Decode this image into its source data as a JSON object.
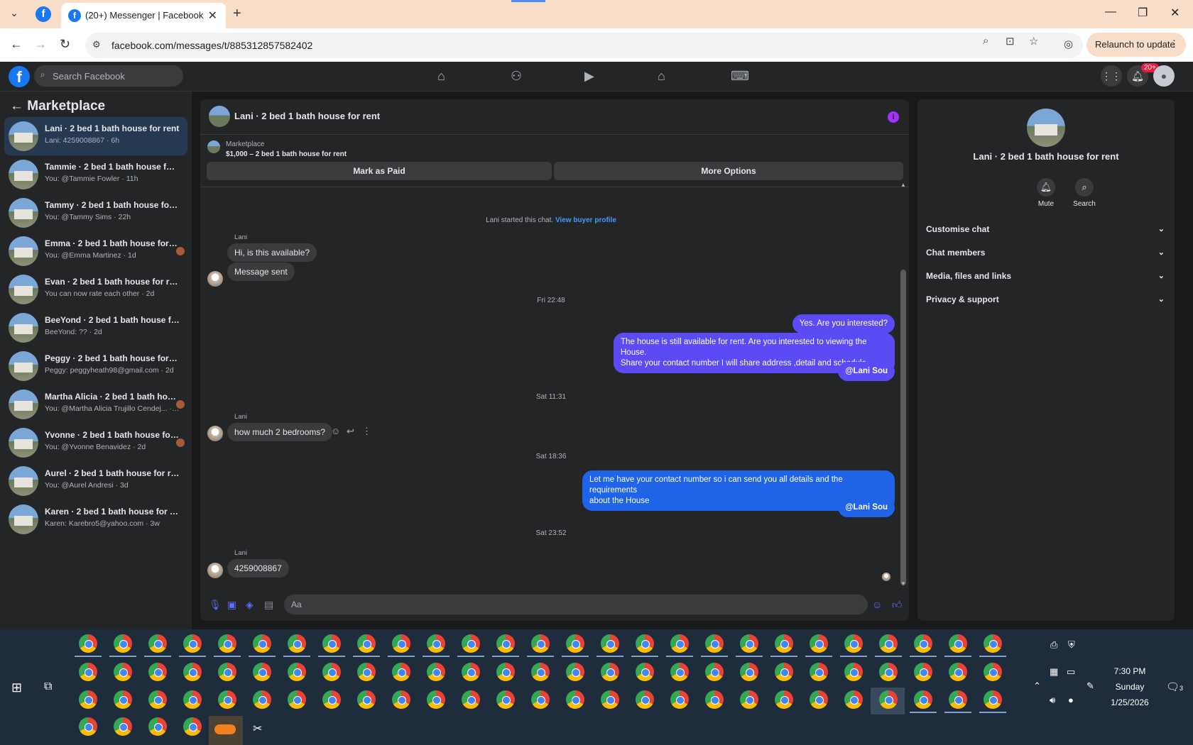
{
  "browser": {
    "tab_title": "(20+) Messenger | Facebook",
    "url": "facebook.com/messages/t/885312857582402",
    "relaunch_label": "Relaunch to update"
  },
  "fb": {
    "search_placeholder": "Search Facebook",
    "notif_badge": "20+"
  },
  "sidebar": {
    "title": "Marketplace",
    "items": [
      {
        "name": "Lani · 2 bed 1 bath house for rent",
        "sub": "Lani: 4259008867 · 6h"
      },
      {
        "name": "Tammie · 2 bed 1 bath house for re...",
        "sub": "You: @Tammie Fowler · 11h"
      },
      {
        "name": "Tammy · 2 bed 1 bath house for rent",
        "sub": "You: @Tammy Sims · 22h"
      },
      {
        "name": "Emma · 2 bed 1 bath house for r...",
        "sub": "You: @Emma Martinez · 1d"
      },
      {
        "name": "Evan · 2 bed 1 bath house for rent",
        "sub": "You can now rate each other · 2d"
      },
      {
        "name": "BeeYond · 2 bed 1 bath house for r...",
        "sub": "BeeYond: ?? · 2d"
      },
      {
        "name": "Peggy · 2 bed 1 bath house for rent",
        "sub": "Peggy: peggyheath98@gmail.com · 2d"
      },
      {
        "name": "Martha Alicia · 2 bed 1 bath hou...",
        "sub": "You: @Martha Alicia Trujillo Cendej... · 2d"
      },
      {
        "name": "Yvonne · 2 bed 1 bath house for ...",
        "sub": "You: @Yvonne Benavidez · 2d"
      },
      {
        "name": "Aurel · 2 bed 1 bath house for rent",
        "sub": "You: @Aurel Andresi · 3d"
      },
      {
        "name": "Karen · 2 bed 1 bath house for rent",
        "sub": "Karen: Karebro5@yahoo.com · 3w"
      }
    ]
  },
  "chat": {
    "title": "Lani · 2 bed 1 bath house for rent",
    "marketplace_label": "Marketplace",
    "listing": "$1,000 – 2 bed 1 bath house for rent",
    "mark_paid": "Mark as Paid",
    "more_options": "More Options",
    "started_text": "Lani started this chat.",
    "view_profile": "View buyer profile",
    "sender": "Lani",
    "m1": "Hi, is this available?",
    "m2": "Message sent",
    "t1": "Fri 22:48",
    "o1": "Yes. Are you interested?",
    "o2a": "The house is still available for rent. Are you interested to viewing  the House.",
    "o2b": "Share your contact number I will share address ,detail and schedule",
    "mention": "@Lani Sou",
    "t2": "Sat 11:31",
    "m3": "how much 2 bedrooms?",
    "t3": "Sat 18:36",
    "o3a": "Let me have your contact number so i can send you all details and the requirements",
    "o3b": "about the House",
    "t4": "Sat 23:52",
    "m4": "4259008867",
    "composer_placeholder": "Aa"
  },
  "right_panel": {
    "name": "Lani · 2 bed 1 bath house for rent",
    "mute": "Mute",
    "search": "Search",
    "sections": [
      "Customise chat",
      "Chat members",
      "Media, files and links",
      "Privacy & support"
    ]
  },
  "taskbar": {
    "time": "7:30 PM",
    "day": "Sunday",
    "date": "1/25/2026",
    "notif_count": "3"
  }
}
